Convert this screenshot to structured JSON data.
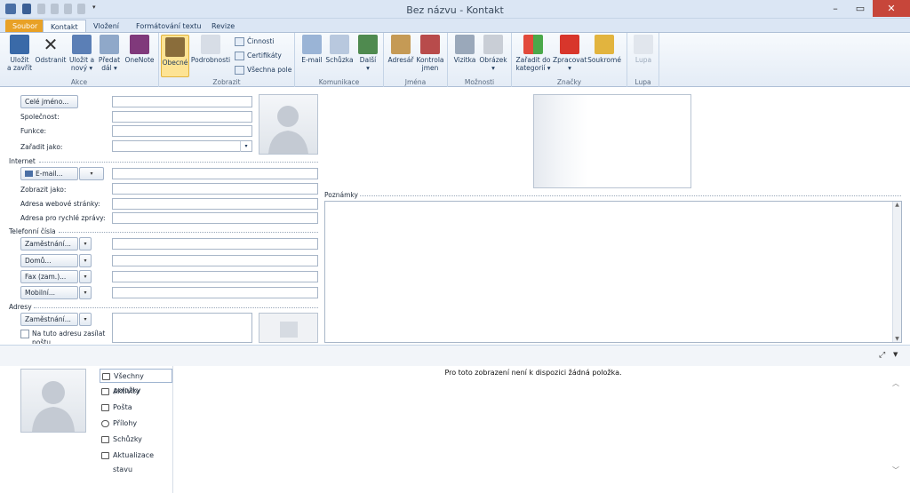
{
  "window": {
    "title": "Bez názvu - Kontakt",
    "min": "–",
    "max": "▭",
    "close": "✕"
  },
  "tabs": [
    {
      "label": "Soubor"
    },
    {
      "label": "Kontakt"
    },
    {
      "label": "Vložení"
    },
    {
      "label": "Formátování textu"
    },
    {
      "label": "Revize"
    }
  ],
  "ribbon": {
    "akce": {
      "label": "Akce",
      "save_l1": "Uložit",
      "save_l2": "a zavřít",
      "delete": "Odstranit",
      "savenew_l1": "Uložit a",
      "savenew_l2": "nový ▾",
      "forward_l1": "Předat",
      "forward_l2": "dál ▾",
      "onenote": "OneNote"
    },
    "zobrazit": {
      "label": "Zobrazit",
      "general": "Obecné",
      "details": "Podrobnosti",
      "activities": "Činnosti",
      "certificates": "Certifikáty",
      "allfields": "Všechna pole"
    },
    "komunikace": {
      "label": "Komunikace",
      "email": "E-mail",
      "meeting": "Schůzka",
      "more_l1": "Další",
      "more_l2": "▾"
    },
    "jmena": {
      "label": "Jména",
      "addressbook": "Adresář",
      "check_l1": "Kontrola",
      "check_l2": "jmen"
    },
    "moznosti": {
      "label": "Možnosti",
      "card": "Vizitka",
      "picture_l1": "Obrázek",
      "picture_l2": "▾"
    },
    "znacky": {
      "label": "Značky",
      "cat_l1": "Zařadit do",
      "cat_l2": "kategorií ▾",
      "followup_l1": "Zpracovat",
      "followup_l2": "▾",
      "private": "Soukromé"
    },
    "lupa": {
      "label": "Lupa",
      "zoom": "Lupa"
    }
  },
  "form": {
    "fullname_btn": "Celé jméno...",
    "company": "Společnost:",
    "jobtitle": "Funkce:",
    "fileas": "Zařadit jako:",
    "internet": "Internet",
    "email_btn": "E-mail...",
    "displayas": "Zobrazit jako:",
    "webpage": "Adresa webové stránky:",
    "im": "Adresa pro rychlé zprávy:",
    "phones": "Telefonní čísla",
    "phone1": "Zaměstnání...",
    "phone2": "Domů...",
    "phone3": "Fax (zam.)...",
    "phone4": "Mobilní...",
    "addresses": "Adresy",
    "addr_btn": "Zaměstnání...",
    "mailing_l1": "Na tuto adresu zasílat",
    "mailing_l2": "poštu",
    "notes": "Poznámky"
  },
  "people": {
    "empty": "Pro toto zobrazení není k dispozici žádná položka.",
    "nav": [
      {
        "label": "Všechny položky"
      },
      {
        "label": "Aktivity"
      },
      {
        "label": "Pošta"
      },
      {
        "label": "Přílohy"
      },
      {
        "label": "Schůzky"
      },
      {
        "label": "Aktualizace stavu"
      }
    ]
  },
  "colors": {
    "file_tab": "#e8a126",
    "selected_button": "#fde394",
    "close_button": "#c7463a"
  }
}
